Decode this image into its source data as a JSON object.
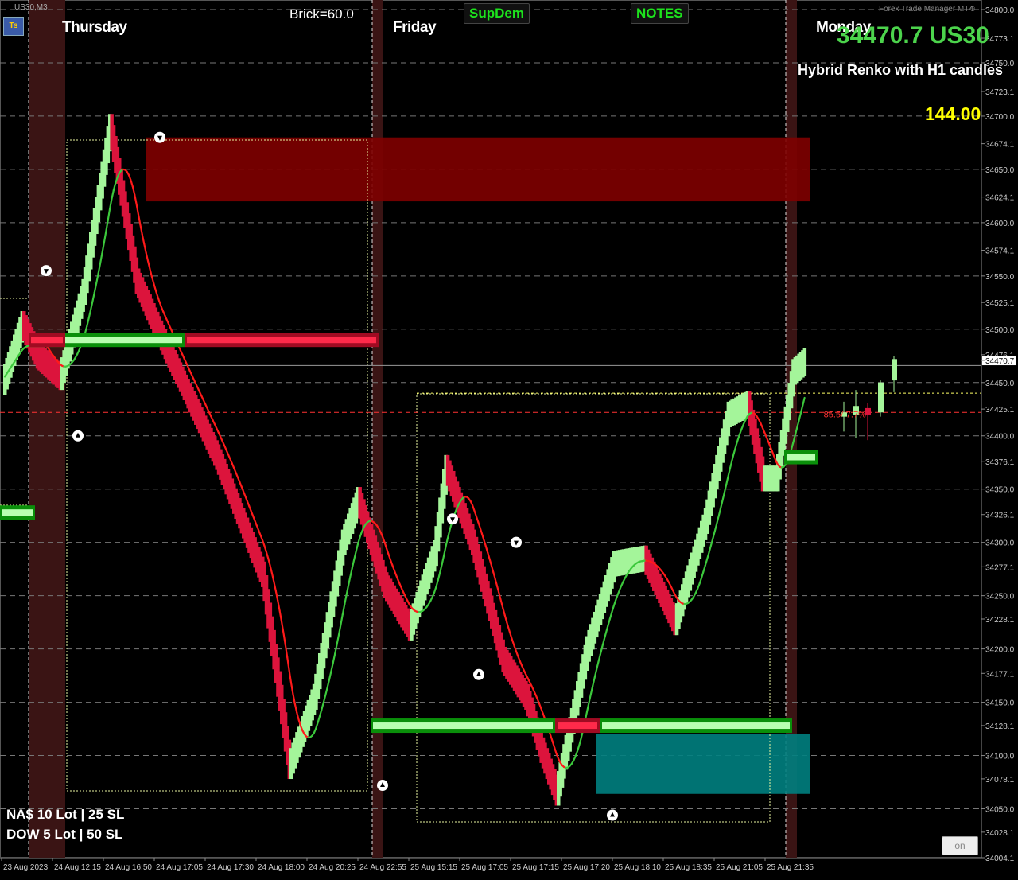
{
  "window": {
    "symbol_label": "US30,M3",
    "top_right_label": "Forex Trade Manager MT4"
  },
  "header": {
    "brick_label": "Brick=60.0",
    "supdem_label": "SupDem",
    "notes_label": "NOTES",
    "price_label": "34470.7 US30",
    "subtitle": "Hybrid Renko with H1 candles",
    "range_value": "144.00",
    "ts_icon_label": "Ts"
  },
  "days": [
    {
      "label": "Thursday"
    },
    {
      "label": "Friday"
    },
    {
      "label": "Monday"
    }
  ],
  "footer": {
    "line1": "NA$ 10 Lot | 25 SL",
    "line2": "DOW 5 Lot | 50 SL",
    "on_button": "on"
  },
  "order_label": "-85.5/-7.7%",
  "colors": {
    "up": "#a4f59a",
    "down": "#dc143c",
    "ma_up": "#3cc83c",
    "ma_down": "#ff1a1a",
    "session": "#3a1414",
    "supply": "#800000",
    "demand": "#008080",
    "sr_green": "#0fae0f",
    "sr_red": "#c8102e",
    "price_green": "#4cd44c",
    "yellow": "#ffff00"
  },
  "chart_data": {
    "type": "candlestick",
    "ylim": [
      34004.1,
      34800.0
    ],
    "y_ticks": [
      "34800.0",
      "34773.1",
      "34750.0",
      "34723.1",
      "34700.0",
      "34674.1",
      "34650.0",
      "34624.1",
      "34600.0",
      "34574.1",
      "34550.0",
      "34525.1",
      "34500.0",
      "34476.1",
      "34470.7",
      "34450.0",
      "34425.1",
      "34400.0",
      "34376.1",
      "34350.0",
      "34326.1",
      "34300.0",
      "34277.1",
      "34250.0",
      "34228.1",
      "34200.0",
      "34177.1",
      "34150.0",
      "34128.1",
      "34100.0",
      "34078.1",
      "34050.0",
      "34028.1",
      "34004.1"
    ],
    "x_tick_labels": [
      "23 Aug 2023",
      "24 Aug 12:15",
      "24 Aug 16:50",
      "24 Aug 17:05",
      "24 Aug 17:30",
      "24 Aug 18:00",
      "24 Aug 20:25",
      "24 Aug 22:55",
      "25 Aug 15:15",
      "25 Aug 17:05",
      "25 Aug 17:15",
      "25 Aug 17:20",
      "25 Aug 18:10",
      "25 Aug 18:35",
      "25 Aug 21:05",
      "25 Aug 21:35"
    ],
    "last_price": 34470.7,
    "brick_size": 60.0,
    "waypoints": [
      [
        0,
        34450
      ],
      [
        10,
        34505
      ],
      [
        18,
        34475
      ],
      [
        30,
        34455
      ],
      [
        42,
        34535
      ],
      [
        56,
        34690
      ],
      [
        70,
        34545
      ],
      [
        86,
        34480
      ],
      [
        112,
        34380
      ],
      [
        136,
        34270
      ],
      [
        150,
        34090
      ],
      [
        163,
        34155
      ],
      [
        178,
        34300
      ],
      [
        186,
        34340
      ],
      [
        200,
        34260
      ],
      [
        213,
        34220
      ],
      [
        226,
        34290
      ],
      [
        232,
        34370
      ],
      [
        246,
        34300
      ],
      [
        262,
        34190
      ],
      [
        274,
        34155
      ],
      [
        282,
        34105
      ],
      [
        290,
        34065
      ],
      [
        306,
        34200
      ],
      [
        320,
        34280
      ],
      [
        336,
        34285
      ],
      [
        352,
        34225
      ],
      [
        368,
        34320
      ],
      [
        380,
        34420
      ],
      [
        390,
        34430
      ],
      [
        398,
        34360
      ],
      [
        405,
        34360
      ],
      [
        414,
        34460
      ],
      [
        420,
        34470
      ]
    ],
    "supply_zone": [
      34620,
      34680
    ],
    "demand_zone": [
      34064,
      34120
    ],
    "sr_lines": [
      {
        "price": 34490,
        "color": "green"
      },
      {
        "price": 34490,
        "color": "red"
      },
      {
        "price": 34328,
        "color": "green"
      },
      {
        "price": 34128,
        "color": "green"
      },
      {
        "price": 34128,
        "color": "red"
      },
      {
        "price": 34380,
        "color": "green"
      }
    ],
    "horizontal_levels": {
      "yellow_dotted": 34440,
      "red_dashed": 34422,
      "gray_solid": 34466
    },
    "arrow_markers": [
      {
        "dir": "down",
        "price": 34680
      },
      {
        "dir": "down",
        "price": 34555
      },
      {
        "dir": "up",
        "price": 34400
      },
      {
        "dir": "down",
        "price": 34322
      },
      {
        "dir": "down",
        "price": 34300
      },
      {
        "dir": "up",
        "price": 34176
      },
      {
        "dir": "up",
        "price": 34072
      },
      {
        "dir": "up",
        "price": 34044
      }
    ]
  }
}
